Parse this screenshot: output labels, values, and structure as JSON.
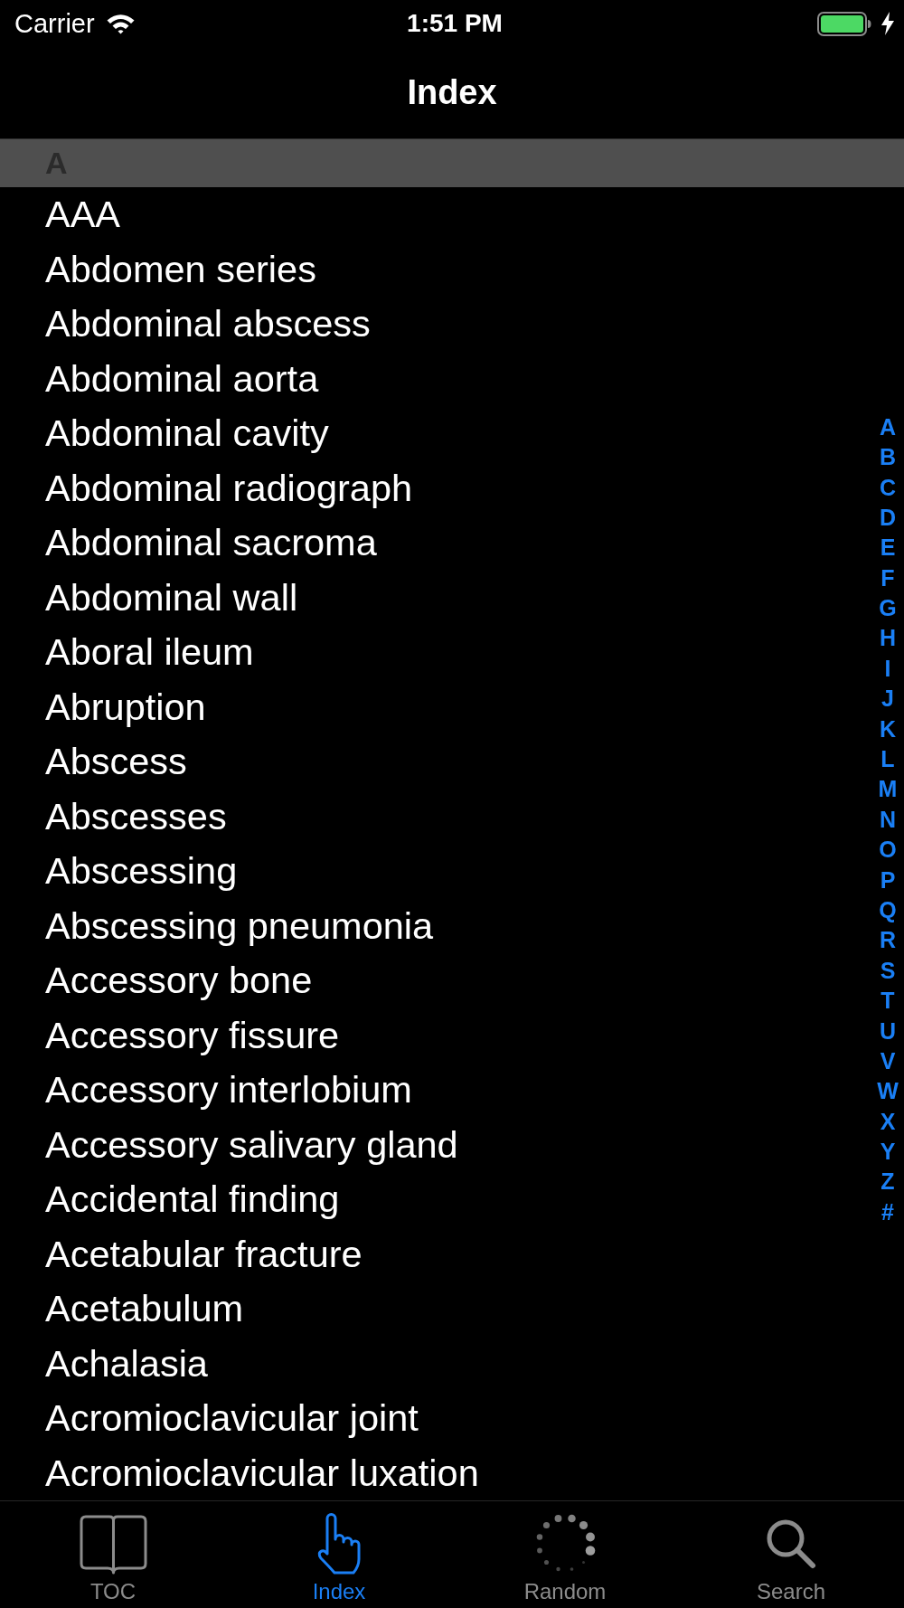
{
  "status_bar": {
    "carrier": "Carrier",
    "time": "1:51 PM",
    "charging": true
  },
  "navigation_bar": {
    "title": "Index"
  },
  "sections": [
    {
      "header": "A",
      "rows": [
        "AAA",
        "Abdomen series",
        "Abdominal abscess",
        "Abdominal aorta",
        "Abdominal cavity",
        "Abdominal radiograph",
        "Abdominal sacroma",
        "Abdominal wall",
        "Aboral ileum",
        "Abruption",
        "Abscess",
        "Abscesses",
        "Abscessing",
        "Abscessing pneumonia",
        "Accessory bone",
        "Accessory fissure",
        "Accessory interlobium",
        "Accessory salivary gland",
        "Accidental finding",
        "Acetabular fracture",
        "Acetabulum",
        "Achalasia",
        "Acromioclavicular joint",
        "Acromioclavicular luxation"
      ]
    }
  ],
  "index_letters": [
    "A",
    "B",
    "C",
    "D",
    "E",
    "F",
    "G",
    "H",
    "I",
    "J",
    "K",
    "L",
    "M",
    "N",
    "O",
    "P",
    "Q",
    "R",
    "S",
    "T",
    "U",
    "V",
    "W",
    "X",
    "Y",
    "Z",
    "#"
  ],
  "tab_bar": [
    {
      "label": "TOC",
      "selected": false
    },
    {
      "label": "Index",
      "selected": true
    },
    {
      "label": "Random",
      "selected": false
    },
    {
      "label": "Search",
      "selected": false
    }
  ]
}
